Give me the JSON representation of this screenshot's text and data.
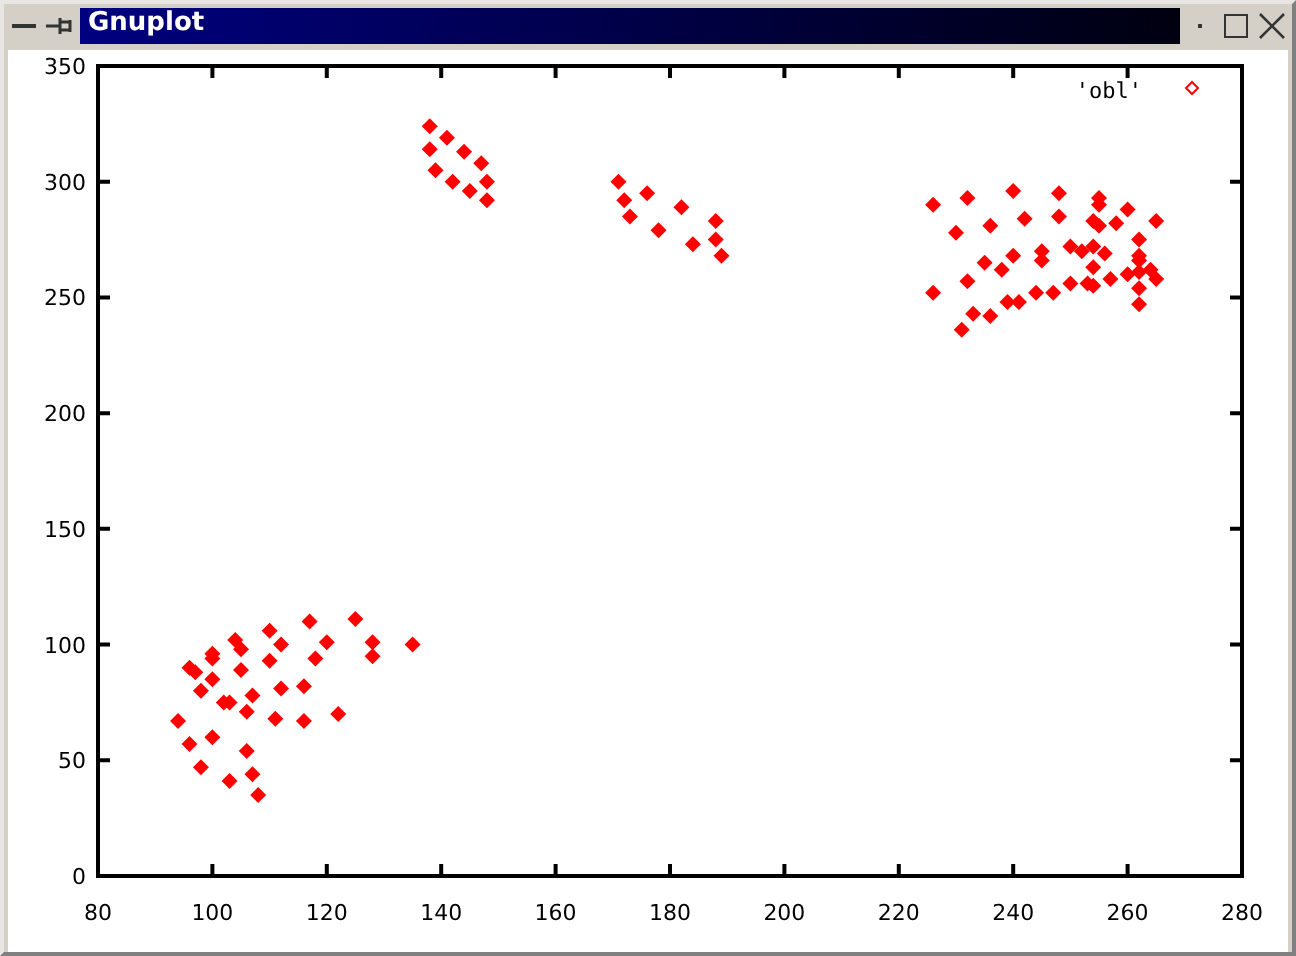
{
  "window": {
    "title": "Gnuplot"
  },
  "plot": {
    "chart_data": {
      "type": "scatter",
      "xlim": [
        80,
        280
      ],
      "ylim": [
        0,
        350
      ],
      "xticks": [
        80,
        100,
        120,
        140,
        160,
        180,
        200,
        220,
        240,
        260,
        280
      ],
      "yticks": [
        0,
        50,
        100,
        150,
        200,
        250,
        300,
        350
      ],
      "x": [
        138,
        141,
        144,
        147,
        148,
        148,
        145,
        142,
        139,
        138,
        171,
        176,
        182,
        188,
        188,
        189,
        184,
        178,
        173,
        172,
        94,
        96,
        98,
        103,
        108,
        107,
        106,
        100,
        97,
        100,
        104,
        110,
        117,
        125,
        96,
        100,
        105,
        112,
        120,
        128,
        135,
        100,
        105,
        110,
        118,
        128,
        98,
        102,
        106,
        111,
        116,
        122,
        103,
        107,
        112,
        116,
        226,
        232,
        240,
        248,
        255,
        260,
        265,
        230,
        236,
        242,
        248,
        254,
        258,
        226,
        232,
        238,
        245,
        252,
        231,
        236,
        241,
        247,
        253,
        260,
        265,
        233,
        239,
        244,
        250,
        257,
        264,
        235,
        240,
        245,
        250,
        256,
        262,
        255,
        255,
        254,
        254,
        254,
        262,
        262,
        262,
        262,
        262
      ],
      "series": [
        {
          "name": "'obl'",
          "color": "#ff0000",
          "values": [
            324,
            319,
            313,
            308,
            300,
            292,
            296,
            300,
            305,
            314,
            300,
            295,
            289,
            283,
            275,
            268,
            273,
            279,
            285,
            292,
            67,
            57,
            47,
            41,
            35,
            44,
            54,
            60,
            88,
            96,
            102,
            106,
            110,
            111,
            90,
            94,
            98,
            100,
            101,
            101,
            100,
            85,
            89,
            93,
            94,
            95,
            80,
            75,
            71,
            68,
            67,
            70,
            75,
            78,
            81,
            82,
            290,
            293,
            296,
            295,
            293,
            288,
            283,
            278,
            281,
            284,
            285,
            283,
            282,
            252,
            257,
            262,
            266,
            270,
            236,
            242,
            248,
            252,
            256,
            260,
            258,
            243,
            248,
            252,
            256,
            258,
            262,
            265,
            268,
            270,
            272,
            269,
            266,
            290,
            281,
            272,
            263,
            255,
            275,
            268,
            261,
            254,
            247
          ]
        }
      ]
    }
  }
}
